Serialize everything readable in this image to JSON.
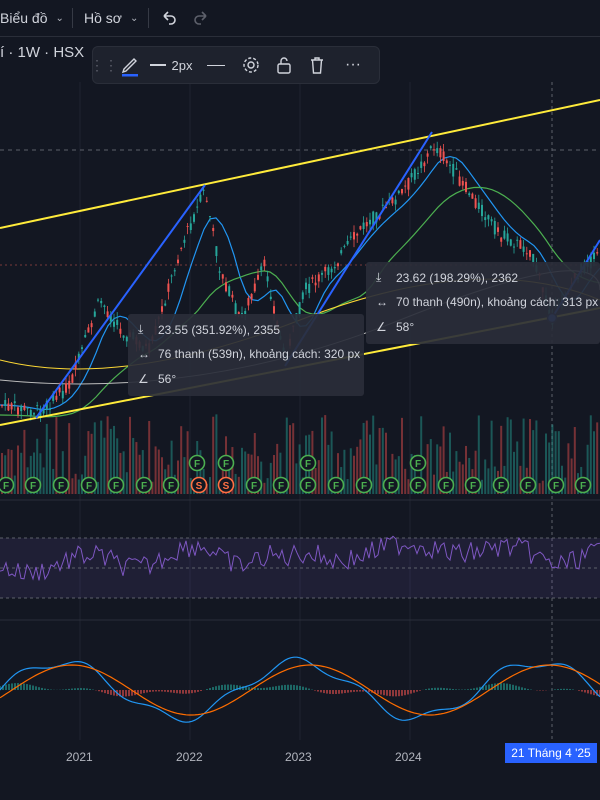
{
  "topbar": {
    "chart_menu": "Biểu đồ",
    "profile_menu": "Hồ sơ",
    "undo_icon": "undo-icon",
    "redo_icon": "redo-icon"
  },
  "symbol_line": "í · 1W · HSX",
  "drawing_toolbar": {
    "width_label": "2px",
    "icons": [
      "drag-handle-icon",
      "pencil-icon",
      "line-width-icon",
      "line-style-icon",
      "settings-icon",
      "lock-icon",
      "trash-icon",
      "more-icon"
    ]
  },
  "info_boxes": [
    {
      "price_change": "23.55 (351.92%), 2355",
      "bars_distance": "76 thanh (539n), khoảng cách: 320 px",
      "angle": "56°"
    },
    {
      "price_change": "23.62 (198.29%), 2362",
      "bars_distance": "70 thanh (490n), khoảng cách: 313 px",
      "angle": "58°"
    }
  ],
  "event_markers": {
    "top_row": [
      "F",
      "F",
      "F",
      "F",
      "F",
      "F",
      "F",
      "F"
    ],
    "bottom_row": [
      "F",
      "F",
      "F",
      "F",
      "F",
      "F",
      "F",
      "S",
      "S",
      "F",
      "F",
      "F",
      "F",
      "F",
      "F",
      "F",
      "F",
      "F",
      "F",
      "F",
      "F",
      "F"
    ]
  },
  "x_axis": [
    "2021",
    "2022",
    "2023",
    "2024"
  ],
  "crosshair_date": "21 Tháng 4 '25",
  "colors": {
    "background": "#131722",
    "channel_line": "#ffeb3b",
    "trend_line": "#2962ff",
    "candle_up": "#26a69a",
    "candle_down": "#ef5350",
    "rsi_line": "#7e57c2",
    "macd_line": "#2196f3",
    "signal_line": "#ff6d00",
    "date_tag": "#2962ff"
  }
}
